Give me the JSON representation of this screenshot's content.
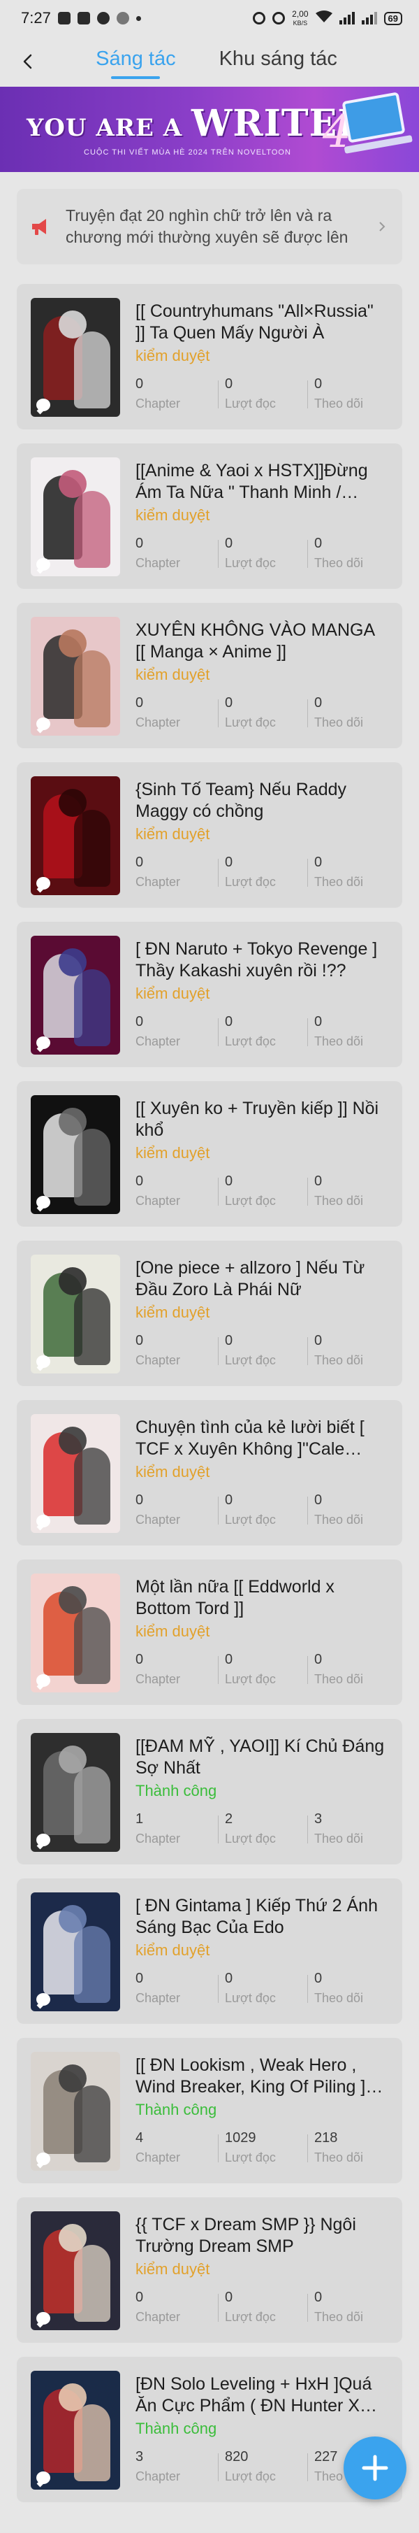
{
  "status_bar": {
    "time": "7:27",
    "speed": "2,00",
    "speed_unit": "KB/S",
    "battery": "69"
  },
  "header": {
    "tabs": [
      {
        "label": "Sáng tác"
      },
      {
        "label": "Khu sáng tác"
      }
    ]
  },
  "banner": {
    "title_a": "YOU ARE A ",
    "title_b": "WRITER",
    "number": "4",
    "subtitle": "CUỘC THI VIẾT MÙA HÈ 2024 TRÊN NOVELTOON"
  },
  "notice": {
    "text": "Truyện đạt 20 nghìn chữ trở lên và ra chương mới thường xuyên sẽ được lên"
  },
  "labels": {
    "chapter": "Chapter",
    "reads": "Lượt đọc",
    "follows": "Theo dõi"
  },
  "stories": [
    {
      "title": "[[ Countryhumans \"All×Russia\" ]] Ta Quen Mấy Người À",
      "status": "kiểm duyệt",
      "status_type": "review",
      "chapter": "0",
      "reads": "0",
      "follows": "0",
      "cover_colors": [
        "#2b2b2b",
        "#8c1f1f",
        "#d9d9d9"
      ]
    },
    {
      "title": "[[Anime & Yaoi x HSTX]]Đừng Ám Ta Nữa \" Thanh Minh / Cheong ...",
      "status": "kiểm duyệt",
      "status_type": "review",
      "chapter": "0",
      "reads": "0",
      "follows": "0",
      "cover_colors": [
        "#f1eef0",
        "#1c1c1c",
        "#c25b7a"
      ]
    },
    {
      "title": "XUYÊN KHÔNG VÀO MANGA [[ Manga × Anime ]]",
      "status": "kiểm duyệt",
      "status_type": "review",
      "chapter": "0",
      "reads": "0",
      "follows": "0",
      "cover_colors": [
        "#e7c7c9",
        "#2a2a2a",
        "#b7785e"
      ]
    },
    {
      "title": "{Sinh Tố Team} Nếu Raddy Maggy có chồng",
      "status": "kiểm duyệt",
      "status_type": "review",
      "chapter": "0",
      "reads": "0",
      "follows": "0",
      "cover_colors": [
        "#5a0d12",
        "#b5121b",
        "#2c0507"
      ]
    },
    {
      "title": "[ ĐN Naruto + Tokyo Revenge ] Thầy Kakashi xuyên rồi !??",
      "status": "kiểm duyệt",
      "status_type": "review",
      "chapter": "0",
      "reads": "0",
      "follows": "0",
      "cover_colors": [
        "#5a0b33",
        "#d9d9e0",
        "#3c3c8c"
      ]
    },
    {
      "title": "[[ Xuyên ko + Truyền kiếp ]] Nồi khổ",
      "status": "kiểm duyệt",
      "status_type": "review",
      "chapter": "0",
      "reads": "0",
      "follows": "0",
      "cover_colors": [
        "#111111",
        "#e8e8e8",
        "#6a6a6a"
      ]
    },
    {
      "title": "[One piece + allzoro ] Nếu Từ Đầu Zoro Là Phái Nữ",
      "status": "kiểm duyệt",
      "status_type": "review",
      "chapter": "0",
      "reads": "0",
      "follows": "0",
      "cover_colors": [
        "#e9e9e0",
        "#3f6b3a",
        "#2b2b2b"
      ]
    },
    {
      "title": "Chuyện tình của kẻ lười biết [ TCF x Xuyên Không ]\"Cale Henituse , ...",
      "status": "kiểm duyệt",
      "status_type": "review",
      "chapter": "0",
      "reads": "0",
      "follows": "0",
      "cover_colors": [
        "#f0e7e7",
        "#d92a2a",
        "#3a3a3a"
      ]
    },
    {
      "title": "Một lần nữa [[ Eddworld x Bottom Tord ]]",
      "status": "kiểm duyệt",
      "status_type": "review",
      "chapter": "0",
      "reads": "0",
      "follows": "0",
      "cover_colors": [
        "#f3d3d0",
        "#d94a2c",
        "#4a4a4a"
      ]
    },
    {
      "title": "[[ĐAM MỸ , YAOI]] Kí Chủ Đáng Sợ Nhất",
      "status": "Thành công",
      "status_type": "success",
      "chapter": "1",
      "reads": "2",
      "follows": "3",
      "cover_colors": [
        "#2e2e2e",
        "#6b6b6b",
        "#a9a9a9"
      ]
    },
    {
      "title": "[ ĐN Gintama ] Kiếp Thứ 2 Ánh Sáng Bạc Của Edo",
      "status": "kiểm duyệt",
      "status_type": "review",
      "chapter": "0",
      "reads": "0",
      "follows": "0",
      "cover_colors": [
        "#1c2a4a",
        "#e8e8ee",
        "#6a7fb0"
      ]
    },
    {
      "title": "[[ ĐN Lookism , Weak Hero , Wind Breaker, King Of Piling ]]< Hả , T...",
      "status": "Thành công",
      "status_type": "success",
      "chapter": "4",
      "reads": "1029",
      "follows": "218",
      "cover_colors": [
        "#d9d4cf",
        "#8a8076",
        "#3c3c3c"
      ]
    },
    {
      "title": "{{ TCF x Dream SMP }} Ngôi Trường Dream SMP",
      "status": "kiểm duyệt",
      "status_type": "review",
      "chapter": "0",
      "reads": "0",
      "follows": "0",
      "cover_colors": [
        "#2a2a3a",
        "#c2302a",
        "#e2d7c8"
      ]
    },
    {
      "title": "[ĐN Solo Leveling + HxH ]Quá Ăn Cực Phẩm ( ĐN Hunter X Hunter...",
      "status": "Thành công",
      "status_type": "success",
      "chapter": "3",
      "reads": "820",
      "follows": "227",
      "cover_colors": [
        "#1a2b48",
        "#b3262a",
        "#e8c9b0"
      ]
    }
  ],
  "icons": {
    "back": "back-arrow-icon",
    "notice": "megaphone-icon",
    "fab": "plus-icon"
  },
  "colors": {
    "accent": "#3aa3ee",
    "review": "#e2a12b",
    "success": "#3bbd3b",
    "alert": "#e34848"
  }
}
